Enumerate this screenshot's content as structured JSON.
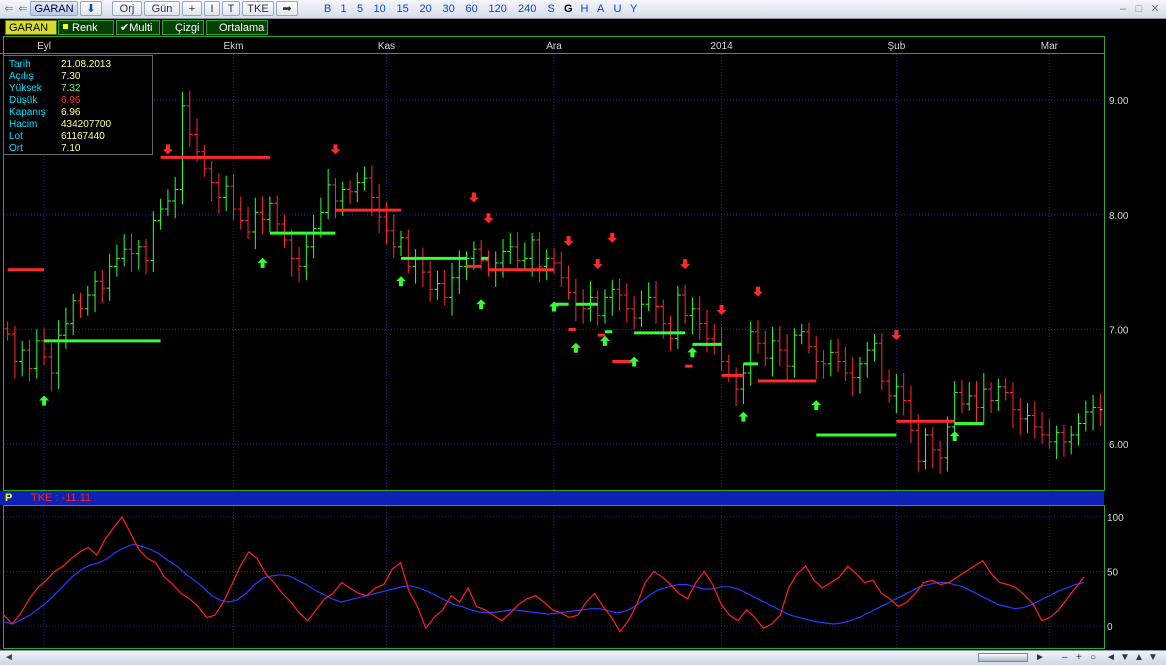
{
  "toolbar": {
    "symbol_tab": "GARAN",
    "symbol_arrow": "⬇",
    "orj": "Orj",
    "gun": "Gün",
    "plus": "+",
    "ibar": "I",
    "tbar": "T",
    "tke": "TKE",
    "arrow": "➡",
    "periods": [
      "B",
      "1",
      "5",
      "10",
      "15",
      "20",
      "30",
      "60",
      "120",
      "240",
      "S",
      "G",
      "H",
      "A",
      "U",
      "Y"
    ],
    "selected_period": "G"
  },
  "options": {
    "symbol": "GARAN",
    "renk": "Renk",
    "multi": "Multi",
    "cizgi": "Çizgi",
    "ortalama": "Ortalama"
  },
  "info": {
    "rows": [
      {
        "k": "Tarih",
        "v": "21.08.2013"
      },
      {
        "k": "Açılış",
        "v": "7.30"
      },
      {
        "k": "Yüksek",
        "v": "7.32"
      },
      {
        "k": "Düşük",
        "v": "6.96"
      },
      {
        "k": "Kapanış",
        "v": "6.96"
      },
      {
        "k": "Hacim",
        "v": "434207700"
      },
      {
        "k": "Lot",
        "v": "61167440"
      },
      {
        "k": "Ort",
        "v": "7.10"
      }
    ]
  },
  "indicator": {
    "label_p": "P",
    "label": "TKE : -11.11"
  },
  "colors": {
    "up": "#33ff33",
    "down": "#ff2a2a",
    "grid": "#1a2a8a",
    "osc_fast": "#ff2020",
    "osc_slow": "#2a3aff",
    "panel_border": "#2aa82a",
    "axis_text": "#d8d8d8"
  },
  "chart_data": {
    "type": "candlestick",
    "months": [
      {
        "label": "Eyl",
        "day": 5
      },
      {
        "label": "Ekm",
        "day": 31
      },
      {
        "label": "Kas",
        "day": 52
      },
      {
        "label": "Ara",
        "day": 75
      },
      {
        "label": "2014",
        "day": 98
      },
      {
        "label": "Şub",
        "day": 122
      },
      {
        "label": "Mar",
        "day": 143
      }
    ],
    "yticks": [
      9.0,
      8.0,
      7.0,
      6.0
    ],
    "ylim": [
      5.6,
      9.55
    ],
    "closes": [
      6.96,
      6.72,
      6.82,
      6.66,
      6.9,
      6.76,
      6.62,
      6.95,
      7.05,
      7.25,
      7.18,
      7.3,
      7.42,
      7.36,
      7.55,
      7.62,
      7.7,
      7.66,
      7.72,
      7.6,
      7.95,
      8.05,
      8.12,
      8.22,
      8.95,
      8.7,
      8.55,
      8.4,
      8.28,
      8.15,
      8.25,
      8.05,
      7.95,
      7.85,
      8.02,
      7.96,
      8.1,
      7.92,
      7.78,
      7.62,
      7.55,
      7.72,
      7.88,
      8.02,
      8.26,
      8.12,
      8.22,
      8.2,
      8.28,
      8.32,
      8.15,
      7.98,
      7.86,
      7.72,
      7.8,
      7.55,
      7.62,
      7.5,
      7.35,
      7.4,
      7.28,
      7.45,
      7.55,
      7.62,
      7.7,
      7.6,
      7.52,
      7.58,
      7.68,
      7.72,
      7.6,
      7.62,
      7.78,
      7.55,
      7.62,
      7.58,
      7.45,
      7.32,
      7.22,
      7.18,
      7.28,
      7.12,
      7.28,
      7.35,
      7.3,
      7.18,
      7.1,
      7.22,
      7.28,
      7.2,
      7.05,
      6.92,
      7.3,
      7.12,
      7.18,
      7.05,
      6.92,
      6.88,
      6.72,
      6.6,
      6.48,
      6.62,
      6.98,
      6.88,
      6.75,
      6.9,
      6.82,
      6.68,
      6.95,
      6.98,
      6.85,
      6.72,
      6.7,
      6.8,
      6.72,
      6.62,
      6.58,
      6.7,
      6.82,
      6.88,
      6.55,
      6.42,
      6.5,
      6.38,
      6.12,
      5.85,
      6.08,
      5.95,
      5.88,
      6.15,
      6.45,
      6.35,
      6.42,
      6.32,
      6.48,
      6.38,
      6.5,
      6.45,
      6.3,
      6.22,
      6.25,
      6.15,
      6.08,
      6.02,
      6.1,
      6.02,
      6.08,
      6.18,
      6.28,
      6.32,
      6.3
    ],
    "segments": [
      {
        "d0": 0,
        "d1": 5,
        "v": 7.52,
        "dir": "down"
      },
      {
        "d0": 5,
        "d1": 21,
        "v": 6.9,
        "dir": "up"
      },
      {
        "d0": 21,
        "d1": 36,
        "v": 8.5,
        "dir": "down"
      },
      {
        "d0": 36,
        "d1": 45,
        "v": 7.84,
        "dir": "up"
      },
      {
        "d0": 45,
        "d1": 54,
        "v": 8.04,
        "dir": "down"
      },
      {
        "d0": 54,
        "d1": 63,
        "v": 7.62,
        "dir": "up"
      },
      {
        "d0": 63,
        "d1": 65,
        "v": 7.55,
        "dir": "down"
      },
      {
        "d0": 65,
        "d1": 66,
        "v": 7.62,
        "dir": "up"
      },
      {
        "d0": 66,
        "d1": 75,
        "v": 7.52,
        "dir": "down"
      },
      {
        "d0": 75,
        "d1": 77,
        "v": 7.22,
        "dir": "up"
      },
      {
        "d0": 77,
        "d1": 78,
        "v": 7.0,
        "dir": "down"
      },
      {
        "d0": 78,
        "d1": 81,
        "v": 7.22,
        "dir": "up"
      },
      {
        "d0": 81,
        "d1": 82,
        "v": 6.95,
        "dir": "down"
      },
      {
        "d0": 82,
        "d1": 83,
        "v": 6.98,
        "dir": "up"
      },
      {
        "d0": 83,
        "d1": 86,
        "v": 6.72,
        "dir": "down"
      },
      {
        "d0": 86,
        "d1": 93,
        "v": 6.97,
        "dir": "up"
      },
      {
        "d0": 93,
        "d1": 94,
        "v": 6.68,
        "dir": "down"
      },
      {
        "d0": 94,
        "d1": 98,
        "v": 6.87,
        "dir": "up"
      },
      {
        "d0": 98,
        "d1": 101,
        "v": 6.6,
        "dir": "down"
      },
      {
        "d0": 101,
        "d1": 103,
        "v": 6.7,
        "dir": "up"
      },
      {
        "d0": 103,
        "d1": 111,
        "v": 6.55,
        "dir": "down"
      },
      {
        "d0": 111,
        "d1": 122,
        "v": 6.08,
        "dir": "up"
      },
      {
        "d0": 122,
        "d1": 130,
        "v": 6.2,
        "dir": "down"
      },
      {
        "d0": 130,
        "d1": 134,
        "v": 6.18,
        "dir": "up"
      }
    ],
    "signals": [
      {
        "d": 5,
        "dir": "up"
      },
      {
        "d": 22,
        "dir": "down"
      },
      {
        "d": 35,
        "dir": "up"
      },
      {
        "d": 45,
        "dir": "down"
      },
      {
        "d": 54,
        "dir": "up"
      },
      {
        "d": 64,
        "dir": "down"
      },
      {
        "d": 65,
        "dir": "up"
      },
      {
        "d": 66,
        "dir": "down"
      },
      {
        "d": 75,
        "dir": "up"
      },
      {
        "d": 77,
        "dir": "down"
      },
      {
        "d": 78,
        "dir": "up"
      },
      {
        "d": 81,
        "dir": "down"
      },
      {
        "d": 82,
        "dir": "up"
      },
      {
        "d": 83,
        "dir": "down"
      },
      {
        "d": 86,
        "dir": "up"
      },
      {
        "d": 93,
        "dir": "down"
      },
      {
        "d": 94,
        "dir": "up"
      },
      {
        "d": 98,
        "dir": "down"
      },
      {
        "d": 101,
        "dir": "up"
      },
      {
        "d": 103,
        "dir": "down"
      },
      {
        "d": 111,
        "dir": "up"
      },
      {
        "d": 122,
        "dir": "down"
      },
      {
        "d": 130,
        "dir": "up"
      }
    ],
    "oscillator": {
      "yticks": [
        100,
        50,
        0
      ],
      "ylim": [
        -20,
        110
      ],
      "fast": [
        10,
        2,
        12,
        25,
        35,
        42,
        50,
        55,
        62,
        68,
        72,
        65,
        80,
        90,
        100,
        85,
        70,
        62,
        58,
        45,
        38,
        30,
        25,
        18,
        8,
        10,
        22,
        38,
        55,
        68,
        62,
        48,
        40,
        30,
        22,
        12,
        5,
        15,
        25,
        30,
        40,
        35,
        30,
        28,
        35,
        38,
        52,
        58,
        32,
        18,
        -2,
        8,
        15,
        28,
        22,
        35,
        18,
        15,
        10,
        5,
        12,
        20,
        25,
        28,
        22,
        15,
        12,
        8,
        10,
        22,
        30,
        18,
        8,
        -5,
        5,
        20,
        40,
        50,
        45,
        38,
        30,
        25,
        40,
        50,
        38,
        20,
        10,
        5,
        15,
        8,
        -2,
        2,
        10,
        35,
        48,
        55,
        42,
        35,
        40,
        45,
        55,
        48,
        40,
        42,
        30,
        25,
        18,
        22,
        30,
        40,
        42,
        38,
        40,
        45,
        50,
        55,
        60,
        48,
        40,
        38,
        35,
        28,
        20,
        5,
        8,
        15,
        25,
        35,
        45
      ],
      "slow": [
        4,
        2,
        6,
        10,
        16,
        22,
        30,
        38,
        46,
        52,
        56,
        58,
        62,
        68,
        72,
        75,
        73,
        70,
        66,
        60,
        55,
        48,
        42,
        36,
        28,
        24,
        22,
        24,
        30,
        38,
        44,
        46,
        47,
        46,
        42,
        38,
        33,
        29,
        25,
        22,
        24,
        26,
        28,
        30,
        32,
        34,
        36,
        37,
        35,
        32,
        28,
        24,
        20,
        18,
        15,
        13,
        12,
        13,
        14,
        15,
        14,
        13,
        12,
        11,
        12,
        13,
        14,
        15,
        16,
        16,
        14,
        12,
        14,
        18,
        24,
        30,
        34,
        36,
        38,
        38,
        36,
        34,
        34,
        36,
        36,
        34,
        30,
        26,
        22,
        18,
        14,
        10,
        8,
        6,
        4,
        3,
        2,
        3,
        5,
        8,
        12,
        16,
        20,
        24,
        28,
        32,
        36,
        38,
        40,
        40,
        38,
        36,
        32,
        28,
        24,
        20,
        18,
        16,
        17,
        20,
        24,
        28,
        32,
        35,
        38,
        40
      ]
    }
  }
}
